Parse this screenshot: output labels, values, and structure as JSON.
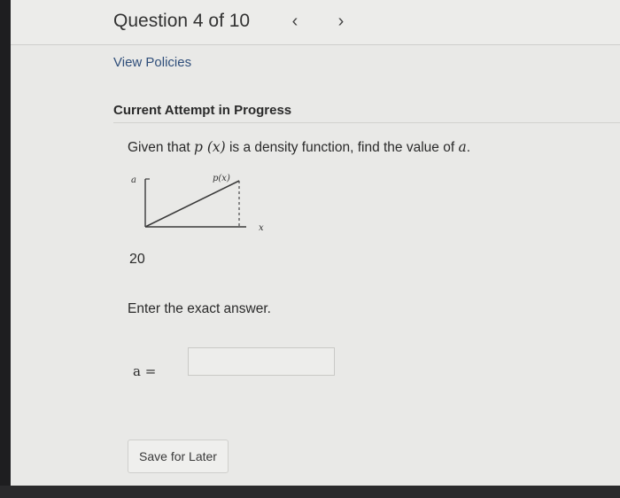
{
  "header": {
    "title": "Question 4 of 10",
    "prev_icon": "‹",
    "next_icon": "›"
  },
  "links": {
    "view_policies": "View Policies"
  },
  "attempt": {
    "status": "Current Attempt in Progress"
  },
  "question": {
    "text_before": "Given that ",
    "text_math": "p (x)",
    "text_middle": " is a density function, find the value of ",
    "text_var": "a",
    "text_end": "."
  },
  "graph": {
    "y_label": "a",
    "curve_label": "p(x)",
    "x_label": "x"
  },
  "given_value": "20",
  "instruction": "Enter the exact answer.",
  "answer": {
    "label": "a =",
    "value": "",
    "placeholder": ""
  },
  "buttons": {
    "save_later": "Save for Later"
  }
}
